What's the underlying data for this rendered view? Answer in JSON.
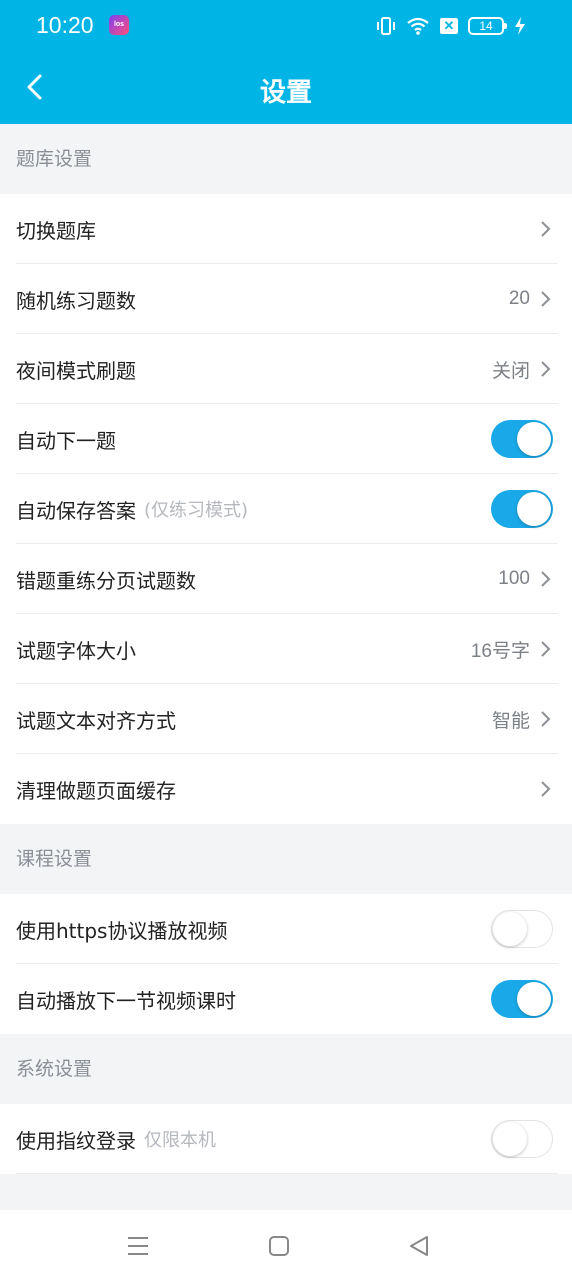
{
  "status_bar": {
    "time": "10:20",
    "app_badge": "los",
    "battery": "14",
    "icons": [
      "vibrate-icon",
      "wifi-icon",
      "x-box-icon",
      "battery-icon",
      "charging-icon"
    ]
  },
  "nav": {
    "title": "设置",
    "back_icon": "chevron-left-icon"
  },
  "sections": {
    "question_bank": {
      "header": "题库设置",
      "rows": [
        {
          "label": "切换题库",
          "value": "",
          "control": "chevron"
        },
        {
          "label": "随机练习题数",
          "value": "20",
          "control": "chevron"
        },
        {
          "label": "夜间模式刷题",
          "value": "关闭",
          "control": "chevron"
        },
        {
          "label": "自动下一题",
          "control": "toggle",
          "on": true
        },
        {
          "label": "自动保存答案",
          "hint": "(仅练习模式)",
          "control": "toggle",
          "on": true
        },
        {
          "label": "错题重练分页试题数",
          "value": "100",
          "control": "chevron"
        },
        {
          "label": "试题字体大小",
          "value": "16号字",
          "control": "chevron"
        },
        {
          "label": "试题文本对齐方式",
          "value": "智能",
          "control": "chevron"
        },
        {
          "label": "清理做题页面缓存",
          "value": "",
          "control": "chevron"
        }
      ]
    },
    "course": {
      "header": "课程设置",
      "rows": [
        {
          "label": "使用https协议播放视频",
          "control": "toggle",
          "on": false
        },
        {
          "label": "自动播放下一节视频课时",
          "control": "toggle",
          "on": true
        }
      ]
    },
    "system": {
      "header": "系统设置",
      "rows": [
        {
          "label": "使用指纹登录",
          "hint": "仅限本机",
          "control": "toggle",
          "on": false
        }
      ]
    }
  },
  "colors": {
    "accent": "#00b4e6",
    "toggle_on": "#1aa9e8",
    "background": "#f3f4f6"
  },
  "bottom_nav": [
    "menu-icon",
    "home-square-icon",
    "back-triangle-icon"
  ]
}
